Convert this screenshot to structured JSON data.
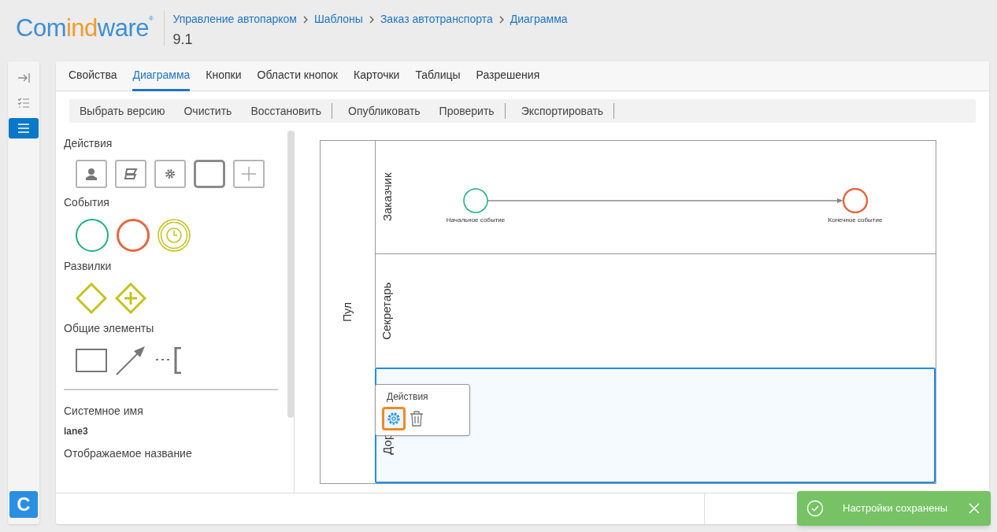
{
  "logo": {
    "parts": [
      {
        "text": "Com",
        "color": "#3d8fd6"
      },
      {
        "text": "ind",
        "color": "#f39a2b"
      },
      {
        "text": "ware",
        "color": "#3d8fd6"
      }
    ],
    "mark": "®"
  },
  "breadcrumbs": [
    "Управление автопарком",
    "Шаблоны",
    "Заказ автотранспорта",
    "Диаграмма"
  ],
  "version": "9.1",
  "rail": [
    {
      "kind": "collapse",
      "selected": false
    },
    {
      "kind": "checklist",
      "selected": false
    },
    {
      "kind": "menu",
      "selected": true
    }
  ],
  "rail_logo": "C",
  "tabs": [
    {
      "label": "Свойства",
      "selected": false
    },
    {
      "label": "Диаграмма",
      "selected": true
    },
    {
      "label": "Кнопки",
      "selected": false
    },
    {
      "label": "Области кнопок",
      "selected": false
    },
    {
      "label": "Карточки",
      "selected": false
    },
    {
      "label": "Таблицы",
      "selected": false
    },
    {
      "label": "Разрешения",
      "selected": false
    }
  ],
  "toolbar": [
    {
      "label": "Выбрать версию",
      "separator": false
    },
    {
      "label": "Очистить",
      "separator": false
    },
    {
      "label": "Восстановить",
      "separator": true
    },
    {
      "label": "Опубликовать",
      "separator": false
    },
    {
      "label": "Проверить",
      "separator": true
    },
    {
      "label": "Экспортировать",
      "separator": true
    }
  ],
  "palette": [
    {
      "title": "Действия",
      "items": [
        {
          "kind": "user-task"
        },
        {
          "kind": "script-task"
        },
        {
          "kind": "service-task"
        },
        {
          "kind": "task"
        },
        {
          "kind": "add"
        }
      ]
    },
    {
      "title": "События",
      "items": [
        {
          "kind": "start"
        },
        {
          "kind": "end"
        },
        {
          "kind": "timer"
        }
      ]
    },
    {
      "title": "Развилки",
      "items": [
        {
          "kind": "gateway"
        },
        {
          "kind": "parallel-gateway"
        }
      ]
    },
    {
      "title": "Общие элементы",
      "items": [
        {
          "kind": "rectangle"
        },
        {
          "kind": "arrow"
        },
        {
          "kind": "annotation"
        }
      ]
    }
  ],
  "properties": {
    "system_name_label": "Системное имя",
    "system_name": "lane3",
    "display_name_label": "Отображаемое название"
  },
  "diagram": {
    "pool": "Пул",
    "lanes": [
      {
        "label": "Заказчик",
        "selected": false
      },
      {
        "label": "Секретарь",
        "selected": false
      },
      {
        "label": "Дор",
        "selected": true
      }
    ],
    "events": [
      {
        "kind": "start",
        "label": "Начальное событие"
      },
      {
        "kind": "end",
        "label": "Конечное событие"
      }
    ],
    "popup": {
      "title": "Действия"
    }
  },
  "toast": {
    "message": "Настройки сохранены"
  }
}
